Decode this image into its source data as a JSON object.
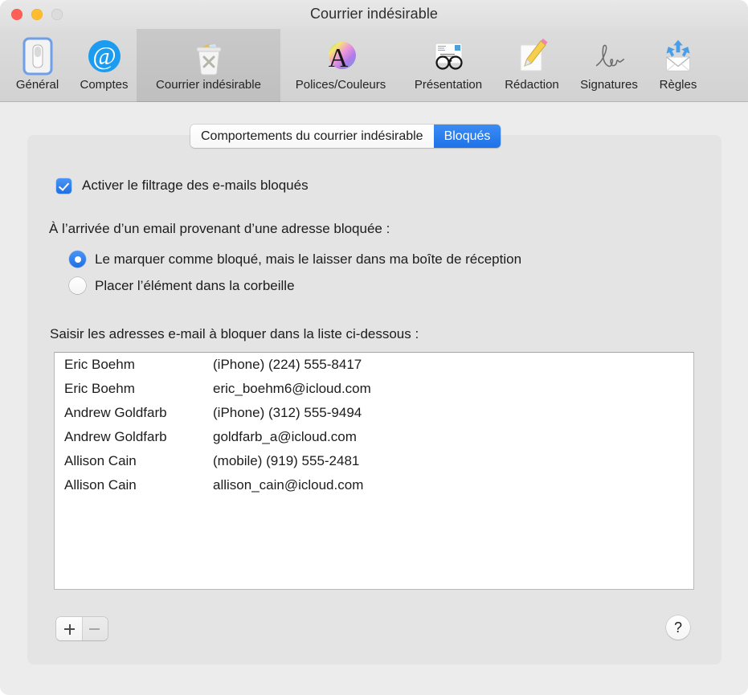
{
  "window": {
    "title": "Courrier indésirable",
    "traffic_lights": [
      {
        "name": "close",
        "color": "#ff5f57"
      },
      {
        "name": "minimize",
        "color": "#febc2e"
      },
      {
        "name": "zoom",
        "color": "#dcdcdc"
      }
    ]
  },
  "toolbar": {
    "items": [
      {
        "label": "Général",
        "icon": "switch-icon",
        "selected": false
      },
      {
        "label": "Comptes",
        "icon": "at-sign-icon",
        "selected": false
      },
      {
        "label": "Courrier indésirable",
        "icon": "junk-trash-icon",
        "selected": true
      },
      {
        "label": "Polices/Couleurs",
        "icon": "font-color-icon",
        "selected": false
      },
      {
        "label": "Présentation",
        "icon": "glasses-icon",
        "selected": false
      },
      {
        "label": "Rédaction",
        "icon": "pencil-page-icon",
        "selected": false
      },
      {
        "label": "Signatures",
        "icon": "signature-icon",
        "selected": false
      },
      {
        "label": "Règles",
        "icon": "rules-envelope-icon",
        "selected": false
      }
    ]
  },
  "tabs": {
    "items": [
      {
        "label": "Comportements du courrier indésirable",
        "active": false
      },
      {
        "label": "Bloqués",
        "active": true
      }
    ],
    "accent_color": "#2a7ded"
  },
  "settings": {
    "enable_checkbox_label": "Activer le filtrage des e-mails bloqués",
    "enable_checkbox_checked": true,
    "prompt": "À l’arrivée d’un email provenant d’une adresse bloquée :",
    "radio_options": [
      {
        "label": "Le marquer comme bloqué, mais le laisser dans ma boîte de réception",
        "selected": true
      },
      {
        "label": "Placer l’élément dans la corbeille",
        "selected": false
      }
    ],
    "list_label": "Saisir les adresses e-mail à bloquer dans la liste ci-dessous :"
  },
  "blocked_list": {
    "rows": [
      {
        "name": "Eric Boehm",
        "address": "(iPhone) (224) 555-8417"
      },
      {
        "name": "Eric Boehm",
        "address": "eric_boehm6@icloud.com"
      },
      {
        "name": "Andrew Goldfarb",
        "address": "(iPhone) (312) 555-9494"
      },
      {
        "name": "Andrew Goldfarb",
        "address": "goldfarb_a@icloud.com"
      },
      {
        "name": "Allison Cain",
        "address": "(mobile) (919) 555-2481"
      },
      {
        "name": "Allison Cain",
        "address": "allison_cain@icloud.com"
      }
    ]
  },
  "actions": {
    "add_label": "+",
    "remove_label": "−",
    "help_label": "?"
  }
}
